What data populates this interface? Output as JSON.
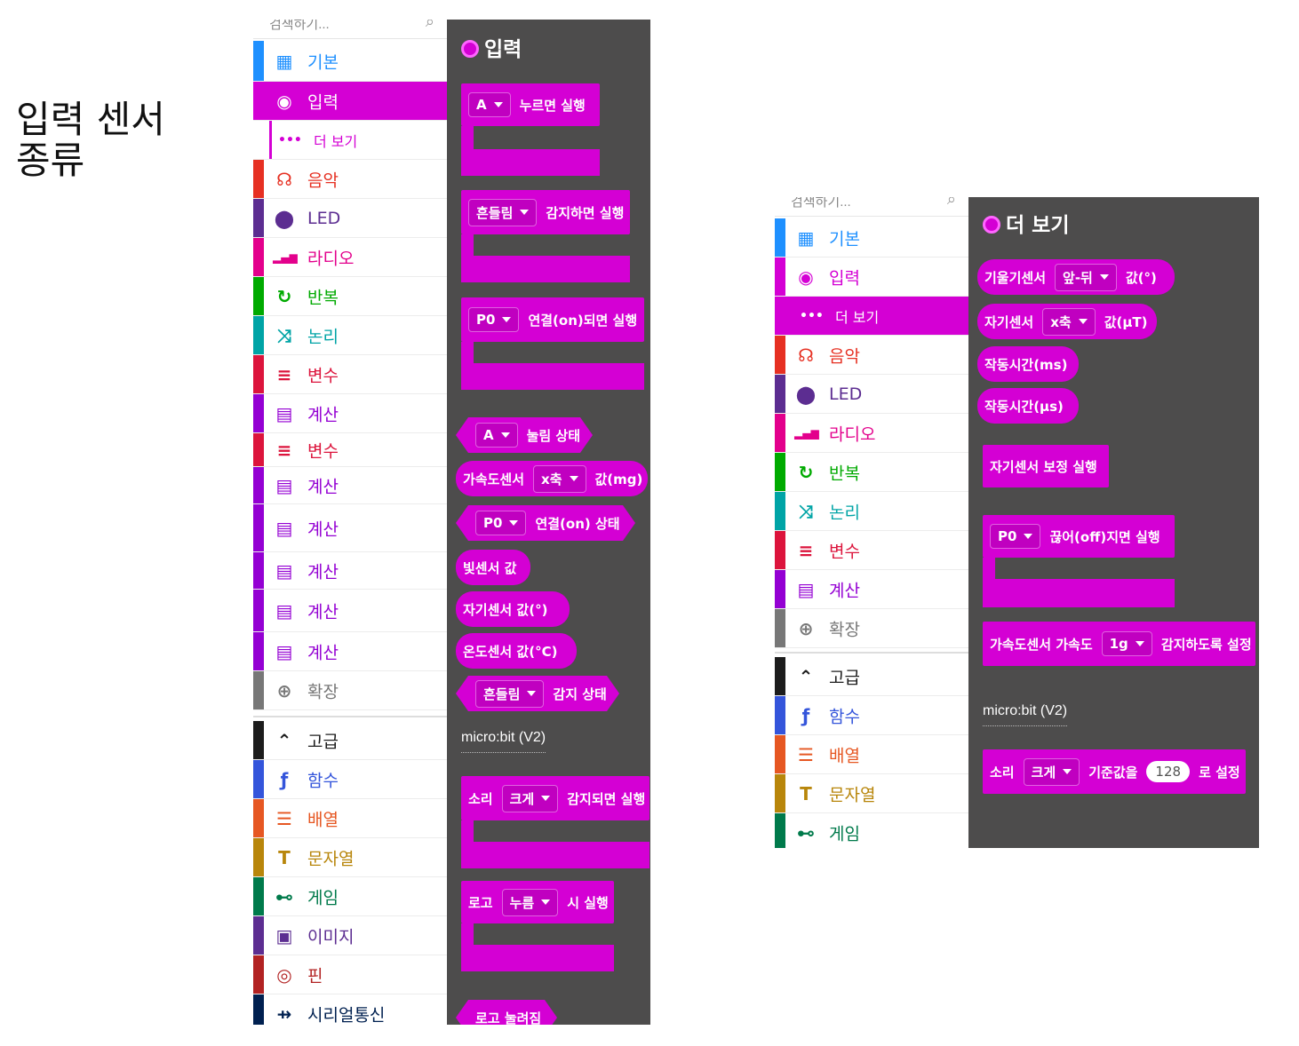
{
  "heading": "입력 센서\n종류",
  "search": {
    "placeholder": "검색하기...",
    "icon": "search-icon"
  },
  "colors": {
    "input": "#d400d4",
    "flyout_bg": "#4d4c4c"
  },
  "left_categories": [
    {
      "label": "기본",
      "color": "#1e90ff",
      "icon": "grid-icon"
    },
    {
      "label": "입력",
      "color": "#d400d4",
      "icon": "record-icon",
      "selected": true
    },
    {
      "label": "더 보기",
      "color": "#d400d4",
      "icon": "more-icon"
    },
    {
      "label": "음악",
      "color": "#e63022",
      "icon": "headphones-icon"
    },
    {
      "label": "LED",
      "color": "#5c2d91",
      "icon": "toggle-icon"
    },
    {
      "label": "라디오",
      "color": "#e3008c",
      "icon": "signal-icon"
    },
    {
      "label": "반복",
      "color": "#00aa00",
      "icon": "loop-icon"
    },
    {
      "label": "논리",
      "color": "#00a4a6",
      "icon": "shuffle-icon"
    },
    {
      "label": "변수",
      "color": "#dc143c",
      "icon": "list-icon"
    },
    {
      "label": "계산",
      "color": "#9400d3",
      "icon": "calculator-icon"
    },
    {
      "label": "변수",
      "color": "#dc143c",
      "icon": "list-icon"
    },
    {
      "label": "계산",
      "color": "#9400d3",
      "icon": "calculator-icon"
    },
    {
      "label": "계산",
      "color": "#9400d3",
      "icon": "calculator-icon"
    },
    {
      "label": "계산",
      "color": "#9400d3",
      "icon": "calculator-icon"
    },
    {
      "label": "계산",
      "color": "#9400d3",
      "icon": "calculator-icon"
    },
    {
      "label": "계산",
      "color": "#9400d3",
      "icon": "calculator-icon"
    },
    {
      "label": "확장",
      "color": "#777777",
      "icon": "plus-circle-icon"
    },
    {
      "label": "고급",
      "color": "#1c1c1c",
      "icon": "chevron-up-icon"
    },
    {
      "label": "함수",
      "color": "#3455db",
      "icon": "function-icon"
    },
    {
      "label": "배열",
      "color": "#e65722",
      "icon": "array-icon"
    },
    {
      "label": "문자열",
      "color": "#b8860b",
      "icon": "text-icon"
    },
    {
      "label": "게임",
      "color": "#007a4b",
      "icon": "gamepad-icon"
    },
    {
      "label": "이미지",
      "color": "#5c2d91",
      "icon": "image-icon"
    },
    {
      "label": "핀",
      "color": "#b22222",
      "icon": "target-icon"
    },
    {
      "label": "시리얼통신",
      "color": "#002050",
      "icon": "usb-icon"
    }
  ],
  "left_flyout": {
    "title": "입력",
    "blocks": {
      "b1": {
        "dd": "A",
        "text": "누르면 실행"
      },
      "b2": {
        "dd": "흔들림",
        "text": "감지하면 실행"
      },
      "b3": {
        "dd": "P0",
        "text": "연결(on)되면 실행"
      },
      "b4": {
        "dd": "A",
        "text": "눌림 상태"
      },
      "b5": {
        "pre": "가속도센서",
        "dd": "x축",
        "text": "값(mg)"
      },
      "b6": {
        "dd": "P0",
        "text": "연결(on) 상태"
      },
      "b7": {
        "text": "빛센서 값"
      },
      "b8": {
        "text": "자기센서 값(°)"
      },
      "b9": {
        "text": "온도센서 값(°C)"
      },
      "b10": {
        "dd": "흔들림",
        "text": "감지 상태"
      },
      "section": "micro:bit (V2)",
      "b11": {
        "pre": "소리",
        "dd": "크게",
        "text": "감지되면 실행"
      },
      "b12": {
        "pre": "로고",
        "dd": "누름",
        "text": "시 실행"
      },
      "b13": {
        "text": "로고 눌려짐"
      }
    }
  },
  "right_categories": [
    {
      "label": "기본",
      "color": "#1e90ff",
      "icon": "grid-icon"
    },
    {
      "label": "입력",
      "color": "#d400d4",
      "icon": "record-icon"
    },
    {
      "label": "더 보기",
      "color": "#d400d4",
      "icon": "more-icon",
      "selected": true
    },
    {
      "label": "음악",
      "color": "#e63022",
      "icon": "headphones-icon"
    },
    {
      "label": "LED",
      "color": "#5c2d91",
      "icon": "toggle-icon"
    },
    {
      "label": "라디오",
      "color": "#e3008c",
      "icon": "signal-icon"
    },
    {
      "label": "반복",
      "color": "#00aa00",
      "icon": "loop-icon"
    },
    {
      "label": "논리",
      "color": "#00a4a6",
      "icon": "shuffle-icon"
    },
    {
      "label": "변수",
      "color": "#dc143c",
      "icon": "list-icon"
    },
    {
      "label": "계산",
      "color": "#9400d3",
      "icon": "calculator-icon"
    },
    {
      "label": "확장",
      "color": "#777777",
      "icon": "plus-circle-icon"
    },
    {
      "label": "고급",
      "color": "#1c1c1c",
      "icon": "chevron-up-icon"
    },
    {
      "label": "함수",
      "color": "#3455db",
      "icon": "function-icon"
    },
    {
      "label": "배열",
      "color": "#e65722",
      "icon": "array-icon"
    },
    {
      "label": "문자열",
      "color": "#b8860b",
      "icon": "text-icon"
    },
    {
      "label": "게임",
      "color": "#007a4b",
      "icon": "gamepad-icon"
    }
  ],
  "right_flyout": {
    "title": "더 보기",
    "blocks": {
      "r1": {
        "pre": "기울기센서",
        "dd": "앞-뒤",
        "text": "값(°)"
      },
      "r2": {
        "pre": "자기센서",
        "dd": "x축",
        "text": "값(μT)"
      },
      "r3": {
        "text": "작동시간(ms)"
      },
      "r4": {
        "text": "작동시간(μs)"
      },
      "r5": {
        "text": "자기센서 보정 실행"
      },
      "r6": {
        "dd": "P0",
        "text": "끊어(off)지면 실행"
      },
      "r7": {
        "pre": "가속도센서 가속도",
        "dd": "1g",
        "text": "감지하도록 설정"
      },
      "section": "micro:bit (V2)",
      "r8": {
        "pre": "소리",
        "dd": "크게",
        "mid": "기준값을",
        "num": "128",
        "text": "로 설정"
      }
    }
  }
}
